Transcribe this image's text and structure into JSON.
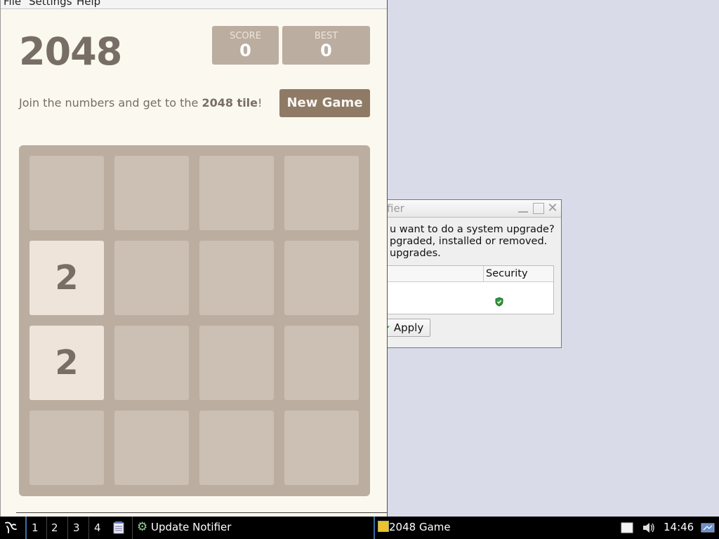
{
  "game_window": {
    "menu": [
      "File",
      "Settings",
      "Help"
    ],
    "title": "2048",
    "score": {
      "label": "SCORE",
      "value": "0"
    },
    "best": {
      "label": "BEST",
      "value": "0"
    },
    "intro": {
      "prefix": "Join the numbers and get to the ",
      "highlight": "2048 tile",
      "suffix": "!"
    },
    "new_game_label": "New Game",
    "grid": [
      [
        "",
        "",
        "",
        ""
      ],
      [
        "2",
        "",
        "",
        ""
      ],
      [
        "2",
        "",
        "",
        ""
      ],
      [
        "",
        "",
        "",
        ""
      ]
    ]
  },
  "notifier": {
    "title": "fier",
    "message_lines": [
      "u want to do a system upgrade?",
      "pgraded, installed or removed.",
      "upgrades."
    ],
    "column_header": "Security",
    "security_icon": "shield-check-icon",
    "apply_label": "Apply"
  },
  "taskbar": {
    "workspaces": [
      "1",
      "2",
      "3",
      "4"
    ],
    "tasks": [
      {
        "label": "Update Notifier",
        "icon": "gear-icon"
      },
      {
        "label": "2048 Game",
        "icon": "game-icon"
      }
    ],
    "clock": "14:46"
  },
  "colors": {
    "grid_bg": "#bbada0",
    "tile_2": "#eee4da",
    "button": "#8f7a66",
    "text": "#776e65",
    "page_bg": "#faf8ef"
  }
}
